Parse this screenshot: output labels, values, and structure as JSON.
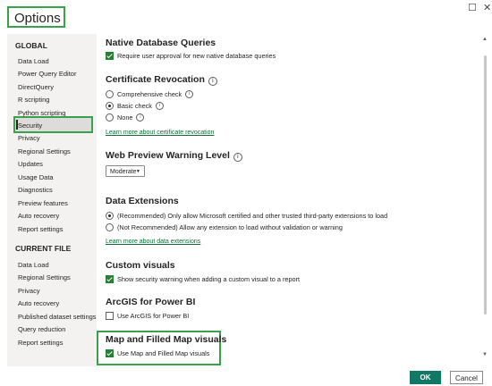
{
  "window": {
    "title": "Options",
    "minimize": "☐",
    "close": "✕"
  },
  "sidebar": {
    "global_header": "GLOBAL",
    "global_items": [
      {
        "label": "Data Load"
      },
      {
        "label": "Power Query Editor"
      },
      {
        "label": "DirectQuery"
      },
      {
        "label": "R scripting"
      },
      {
        "label": "Python scripting"
      },
      {
        "label": "Security"
      },
      {
        "label": "Privacy"
      },
      {
        "label": "Regional Settings"
      },
      {
        "label": "Updates"
      },
      {
        "label": "Usage Data"
      },
      {
        "label": "Diagnostics"
      },
      {
        "label": "Preview features"
      },
      {
        "label": "Auto recovery"
      },
      {
        "label": "Report settings"
      }
    ],
    "selected": "Security",
    "current_header": "CURRENT FILE",
    "current_items": [
      {
        "label": "Data Load"
      },
      {
        "label": "Regional Settings"
      },
      {
        "label": "Privacy"
      },
      {
        "label": "Auto recovery"
      },
      {
        "label": "Published dataset settings"
      },
      {
        "label": "Query reduction"
      },
      {
        "label": "Report settings"
      }
    ]
  },
  "content": {
    "native_db": {
      "title": "Native Database Queries",
      "checkbox_label": "Require user approval for new native database queries",
      "checked": true
    },
    "cert": {
      "title": "Certificate Revocation",
      "options": [
        {
          "label": "Comprehensive check",
          "selected": false
        },
        {
          "label": "Basic check",
          "selected": true
        },
        {
          "label": "None",
          "selected": false
        }
      ],
      "link": "Learn more about certificate revocation"
    },
    "web_preview": {
      "title": "Web Preview Warning Level",
      "dropdown_value": "Moderate"
    },
    "data_ext": {
      "title": "Data Extensions",
      "options": [
        {
          "label": "(Recommended) Only allow Microsoft certified and other trusted third-party extensions to load",
          "selected": true
        },
        {
          "label": "(Not Recommended) Allow any extension to load without validation or warning",
          "selected": false
        }
      ],
      "link": "Learn more about data extensions"
    },
    "custom_visuals": {
      "title": "Custom visuals",
      "checkbox_label": "Show security warning when adding a custom visual to a report",
      "checked": true
    },
    "arcgis": {
      "title": "ArcGIS for Power BI",
      "checkbox_label": "Use ArcGIS for Power BI",
      "checked": false
    },
    "map_visuals": {
      "title": "Map and Filled Map visuals",
      "checkbox_label": "Use Map and Filled Map visuals",
      "checked": true
    }
  },
  "buttons": {
    "ok": "OK",
    "cancel": "Cancel"
  },
  "colors": {
    "accent": "#117865",
    "highlight": "#3aa04c",
    "checkbox": "#2a7f36",
    "link": "#0e6b3a",
    "sidebar_bg": "#f3f2f1"
  }
}
